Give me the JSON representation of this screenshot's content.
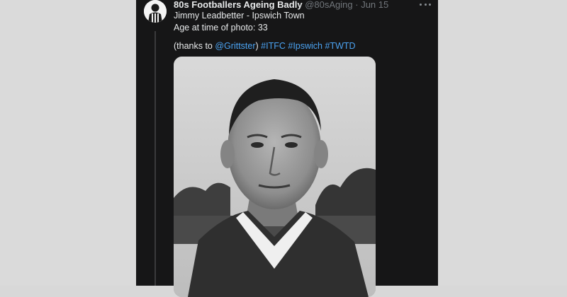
{
  "tweet": {
    "author_name": "80s Footballers Ageing Badly",
    "handle": "@80sAging",
    "separator": "·",
    "date": "Jun 15",
    "line1": "Jimmy Leadbetter - Ipswich Town",
    "line2": "Age at time of photo: 33",
    "thanks_open": "(thanks to ",
    "mention": "@Grittster",
    "thanks_close": ") ",
    "hashtags": [
      "#ITFC",
      "#Ipswich",
      "#TWTD"
    ]
  },
  "icons": {
    "more": "more-options-icon",
    "avatar": "avatar"
  },
  "colors": {
    "panel_bg": "#161617",
    "link": "#4ba3f2",
    "text": "#e7e9ea",
    "muted": "#71767b"
  }
}
